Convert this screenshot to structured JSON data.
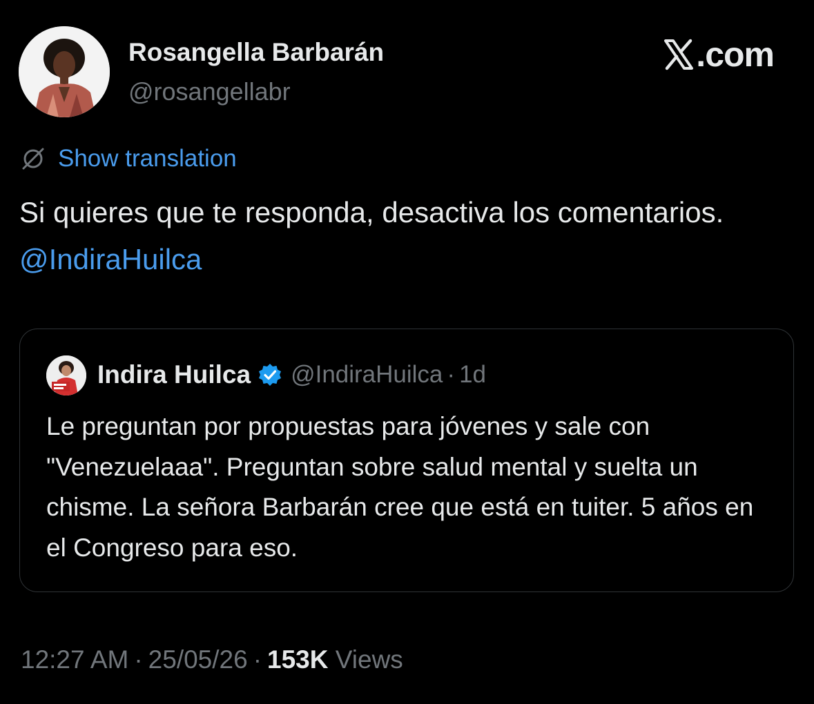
{
  "author": {
    "name": "Rosangella Barbarán",
    "handle": "@rosangellabr",
    "avatar_icon": "profile-photo"
  },
  "brand": {
    "text": ".com",
    "icon": "x-logo-icon"
  },
  "translate": {
    "label": "Show translation",
    "icon": "translate-icon"
  },
  "tweet": {
    "text": "Si quieres que te responda, desactiva los comentarios.",
    "mention": "@IndiraHuilca"
  },
  "quoted_tweet": {
    "author_name": "Indira Huilca",
    "handle": "@IndiraHuilca",
    "separator": "·",
    "time_ago": "1d",
    "verified_icon": "verified-badge-icon",
    "text": "Le preguntan por propuestas para jóvenes y sale con \"Venezuelaaa\". Preguntan sobre salud mental y suelta un chisme. La señora Barbarán cree que está en tuiter. 5 años en el Congreso para eso."
  },
  "meta": {
    "time": "12:27 AM",
    "date": "25/05/26",
    "separator": "·",
    "views_count": "153K",
    "views_label": "Views"
  },
  "colors": {
    "background": "#000000",
    "text_primary": "#e7e9ea",
    "text_secondary": "#71767b",
    "link": "#4a9ced",
    "border": "#2f3336"
  }
}
